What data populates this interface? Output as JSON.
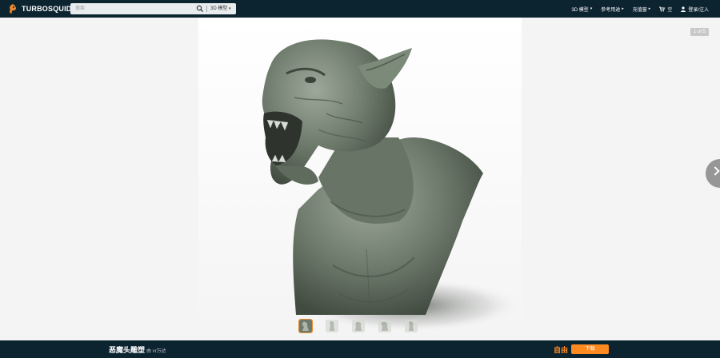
{
  "header": {
    "logo_text": "TURBOSQUID",
    "search": {
      "placeholder": "搜索",
      "category": "3D 模型"
    },
    "nav": [
      {
        "label": "3D 模型"
      },
      {
        "label": "参考用途"
      },
      {
        "label": "充值窗"
      },
      {
        "label": "空"
      },
      {
        "label": "登录/注入"
      }
    ]
  },
  "viewer": {
    "counter": "1 of 5",
    "thumbnail_count": 5,
    "active_thumbnail": 1
  },
  "product": {
    "title": "恶魔头雕塑",
    "by": "由 vr万达",
    "price": "自由",
    "download_label": "下载"
  },
  "colors": {
    "nav_bg": "#0c2330",
    "accent": "#ff8a1f",
    "model": "#6e7b6c"
  },
  "icons": {
    "search": "search-icon",
    "cart": "cart-icon",
    "user": "user-icon",
    "next": "chevron-right-icon"
  }
}
